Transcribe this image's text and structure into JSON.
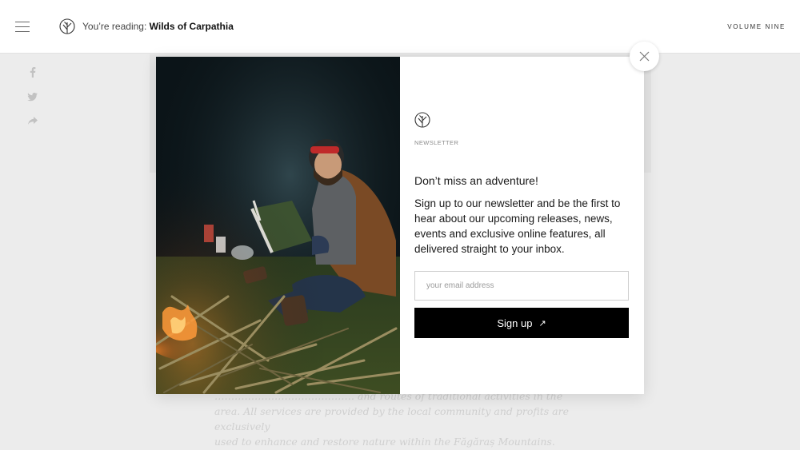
{
  "header": {
    "reading_prefix": "You’re reading:",
    "reading_title": "Wilds of Carpathia",
    "volume": "VOLUME NINE"
  },
  "background": {
    "text_lines": [
      "…………………………………… and routes of traditional activities in the",
      "area. All services are provided by the local community and profits are exclusively",
      "used to enhance and restore nature within the Făgăraș Mountains."
    ]
  },
  "newsletter": {
    "eyebrow": "NEWSLETTER",
    "heading": "Don’t miss an adventure!",
    "body": "Sign up to our newsletter and be the first to hear about our upcoming releases, news, events and exclusive online features, all delivered straight to your inbox.",
    "email_placeholder": "your email address",
    "email_value": "",
    "signup_label": "Sign up",
    "signup_arrow": "↗"
  },
  "icons": {
    "menu": "hamburger-menu-icon",
    "logo": "leaf-logo-icon",
    "close": "close-icon",
    "share": [
      "facebook-icon",
      "twitter-icon",
      "share-arrow-icon"
    ]
  },
  "colors": {
    "button_bg": "#000000",
    "button_text": "#ffffff",
    "overlay": "#ececec"
  }
}
